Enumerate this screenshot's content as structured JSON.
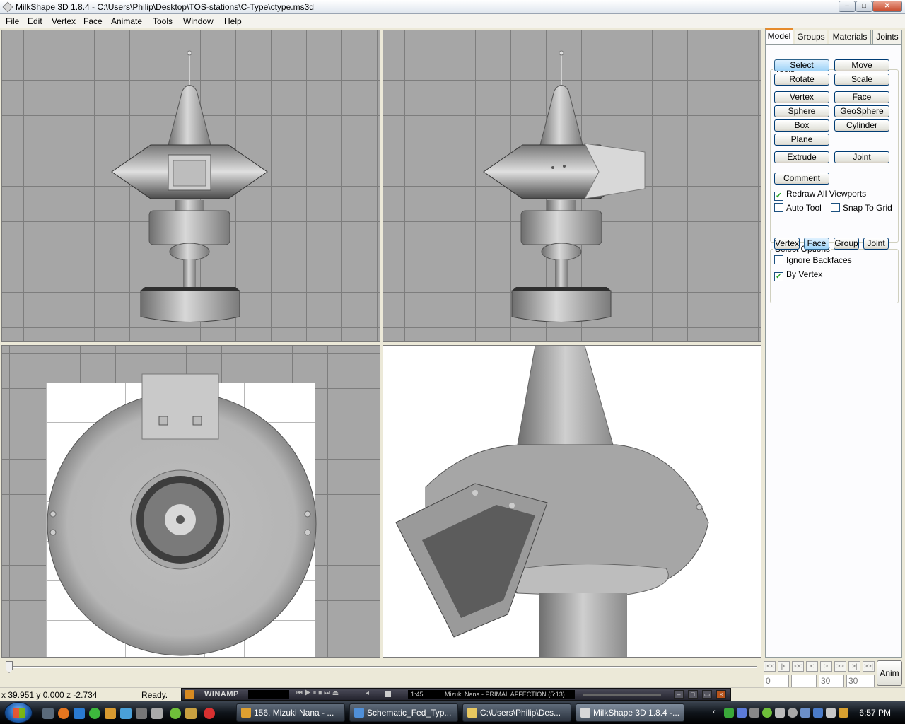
{
  "window": {
    "title": "MilkShape 3D 1.8.4 - C:\\Users\\Philip\\Desktop\\TOS-stations\\C-Type\\ctype.ms3d",
    "min_glyph": "–",
    "max_glyph": "□",
    "close_glyph": "✕"
  },
  "menu": [
    "File",
    "Edit",
    "Vertex",
    "Face",
    "Animate",
    "Tools",
    "Window",
    "Help"
  ],
  "tabs": [
    "Model",
    "Groups",
    "Materials",
    "Joints"
  ],
  "tools": {
    "legend": "Tools",
    "select": "Select",
    "move": "Move",
    "rotate": "Rotate",
    "scale": "Scale",
    "vertex": "Vertex",
    "face": "Face",
    "sphere": "Sphere",
    "geosphere": "GeoSphere",
    "box": "Box",
    "cylinder": "Cylinder",
    "plane": "Plane",
    "extrude": "Extrude",
    "joint": "Joint",
    "comment": "Comment",
    "redraw_all": "Redraw All Viewports",
    "auto_tool": "Auto Tool",
    "snap_to_grid": "Snap To Grid",
    "redraw_checked": true,
    "auto_tool_checked": false,
    "snap_checked": false
  },
  "select_options": {
    "legend": "Select Options",
    "vertex": "Vertex",
    "face": "Face",
    "group": "Group",
    "joint": "Joint",
    "ignore_backfaces": "Ignore Backfaces",
    "by_vertex": "By Vertex",
    "ignore_checked": false,
    "by_vertex_checked": true
  },
  "animation": {
    "frame_buttons": [
      "|<<",
      "|<",
      "<<",
      "<",
      ">",
      ">>",
      ">|",
      ">>|"
    ],
    "current_frame": "0",
    "total_frames_a": "30",
    "total_frames_b": "30",
    "anim_label": "Anim"
  },
  "status": {
    "coords": "x 39.951 y 0.000 z -2.734",
    "state": "Ready."
  },
  "winamp": {
    "title": "WINAMP",
    "time": "1:45",
    "song": "Mizuki Nana - PRIMAL AFFECTION (5:13)",
    "controls": "⏮ ▶ ⏸ ⏹ ⏭ ⏏"
  },
  "taskbar": {
    "items": [
      {
        "label": "156. Mizuki Nana - ...",
        "color": "#e0a030"
      },
      {
        "label": "Schematic_Fed_Typ...",
        "color": "#4f8fd8"
      },
      {
        "label": "C:\\Users\\Philip\\Des...",
        "color": "#e8c860"
      },
      {
        "label": "MilkShape 3D 1.8.4 -...",
        "color": "#d8d8d8"
      }
    ],
    "clock": "6:57 PM"
  }
}
